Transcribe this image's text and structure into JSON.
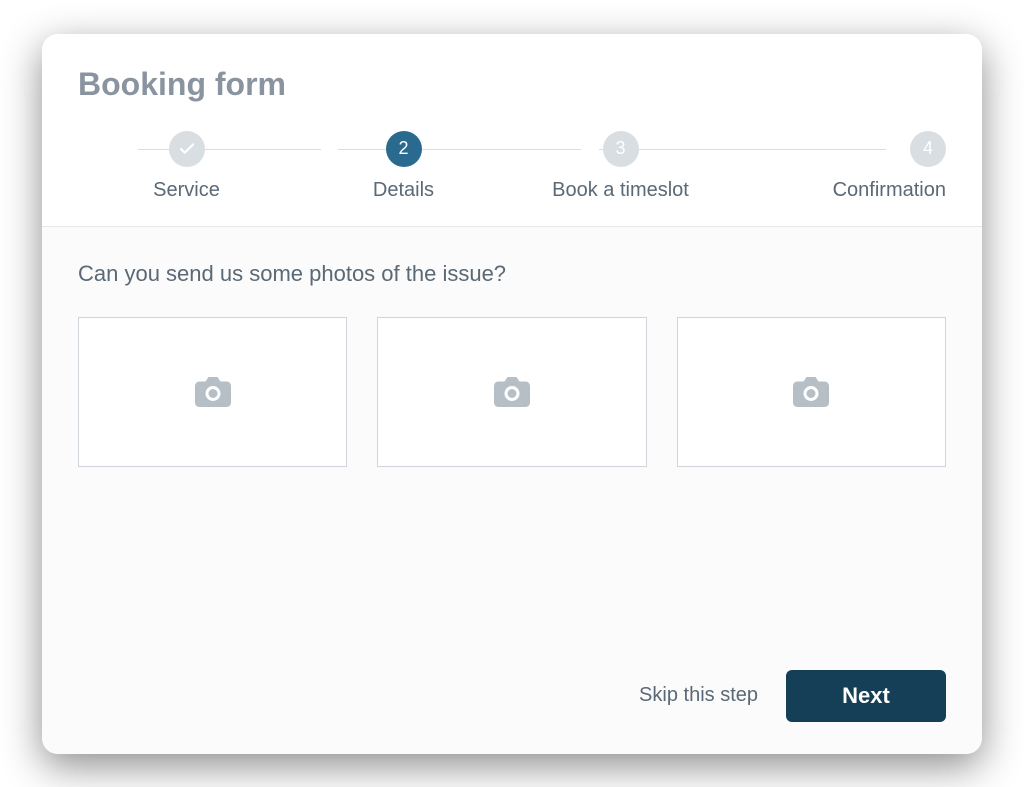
{
  "title": "Booking form",
  "steps": [
    {
      "label": "Service",
      "indicator": "check",
      "state": "done"
    },
    {
      "label": "Details",
      "indicator": "2",
      "state": "active"
    },
    {
      "label": "Book a timeslot",
      "indicator": "3",
      "state": "upcoming"
    },
    {
      "label": "Confirmation",
      "indicator": "4",
      "state": "upcoming"
    }
  ],
  "question": "Can you send us some photos of the issue?",
  "upload_slots": 3,
  "footer": {
    "skip_label": "Skip this step",
    "next_label": "Next"
  },
  "colors": {
    "accent": "#2a6a8e",
    "button": "#153f56",
    "muted_text": "#5a6975"
  }
}
